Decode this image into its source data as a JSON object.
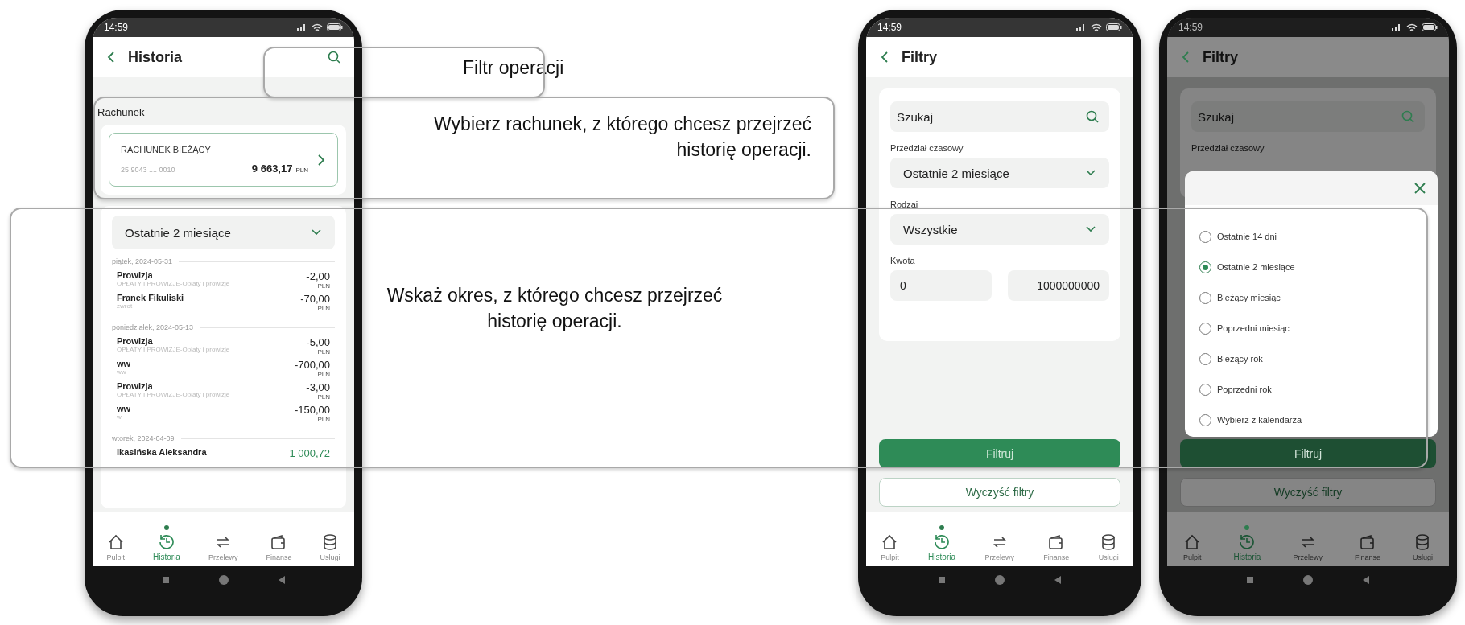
{
  "annotations": [
    {
      "text": "Filtr operacji"
    },
    {
      "text": "Wybierz rachunek, z którego chcesz przejrzeć historię operacji."
    },
    {
      "text": "Wskaż okres, z którego chcesz przejrzeć historię operacji."
    }
  ],
  "phones": [
    {
      "kind": "history",
      "time": "14:59",
      "title": "Historia",
      "section_label": "Rachunek",
      "account": {
        "name": "RACHUNEK BIEŻĄCY",
        "number": "25 9043 .... 0010",
        "balance": "9 663,17",
        "currency": "PLN"
      },
      "period": "Ostatnie 2 miesiące",
      "groups": [
        {
          "date": "piątek, 2024-05-31",
          "items": [
            {
              "title": "Prowizja",
              "subtitle": "OPŁATY I PROWIZJE-Opłaty i prowizje",
              "amount": "-2,00",
              "currency": "PLN",
              "kind": "expense"
            },
            {
              "title": "Franek Fikuliski",
              "subtitle": "zwrot",
              "amount": "-70,00",
              "currency": "PLN",
              "kind": "expense"
            }
          ]
        },
        {
          "date": "poniedziałek, 2024-05-13",
          "items": [
            {
              "title": "Prowizja",
              "subtitle": "OPŁATY I PROWIZJE-Opłaty i prowizje",
              "amount": "-5,00",
              "currency": "PLN",
              "kind": "expense"
            },
            {
              "title": "ww",
              "subtitle": "ww",
              "amount": "-700,00",
              "currency": "PLN",
              "kind": "expense"
            },
            {
              "title": "Prowizja",
              "subtitle": "OPŁATY I PROWIZJE-Opłaty i prowizje",
              "amount": "-3,00",
              "currency": "PLN",
              "kind": "expense"
            },
            {
              "title": "ww",
              "subtitle": "w",
              "amount": "-150,00",
              "currency": "PLN",
              "kind": "expense"
            }
          ]
        },
        {
          "date": "wtorek, 2024-04-09",
          "items": [
            {
              "title": "Ikasińska Aleksandra",
              "amount": "1 000,72",
              "kind": "income"
            }
          ]
        }
      ],
      "nav": [
        {
          "label": "Pulpit",
          "selected": false
        },
        {
          "label": "Historia",
          "selected": true
        },
        {
          "label": "Przelewy",
          "selected": false
        },
        {
          "label": "Finanse",
          "selected": false
        },
        {
          "label": "Usługi",
          "selected": false
        }
      ]
    },
    {
      "kind": "filters",
      "time": "14:59",
      "title": "Filtry",
      "search": {
        "placeholder": "Szukaj"
      },
      "fields": [
        {
          "label": "Przedział czasowy",
          "kind": "select",
          "value": "Ostatnie 2 miesiące"
        },
        {
          "label": "Rodzaj",
          "kind": "select",
          "value": "Wszystkie"
        },
        {
          "label": "Kwota",
          "kind": "range",
          "from": "0",
          "to": "1000000000"
        }
      ],
      "buttons": [
        {
          "label": "Filtruj",
          "kind": "primary"
        },
        {
          "label": "Wyczyść filtry",
          "kind": "secondary"
        }
      ],
      "nav": [
        {
          "label": "Pulpit",
          "selected": false
        },
        {
          "label": "Historia",
          "selected": true
        },
        {
          "label": "Przelewy",
          "selected": false
        },
        {
          "label": "Finanse",
          "selected": false
        },
        {
          "label": "Usługi",
          "selected": false
        }
      ]
    },
    {
      "kind": "filters",
      "time": "14:59",
      "title": "Filtry",
      "search": {
        "placeholder": "Szukaj"
      },
      "fields": [
        {
          "label": "Przedział czasowy",
          "kind": "label"
        }
      ],
      "buttons": [
        {
          "label": "Filtruj",
          "kind": "primary"
        },
        {
          "label": "Wyczyść filtry",
          "kind": "secondary"
        }
      ],
      "modal": {
        "options": [
          {
            "label": "Ostatnie 14 dni",
            "selected": false
          },
          {
            "label": "Ostatnie 2 miesiące",
            "selected": true
          },
          {
            "label": "Bieżący miesiąc",
            "selected": false
          },
          {
            "label": "Poprzedni miesiąc",
            "selected": false
          },
          {
            "label": "Bieżący rok",
            "selected": false
          },
          {
            "label": "Poprzedni rok",
            "selected": false
          },
          {
            "label": "Wybierz z kalendarza",
            "selected": false
          }
        ]
      },
      "nav": [
        {
          "label": "Pulpit",
          "selected": false
        },
        {
          "label": "Historia",
          "selected": true
        },
        {
          "label": "Przelewy",
          "selected": false
        },
        {
          "label": "Finanse",
          "selected": false
        },
        {
          "label": "Usługi",
          "selected": false
        }
      ]
    }
  ]
}
